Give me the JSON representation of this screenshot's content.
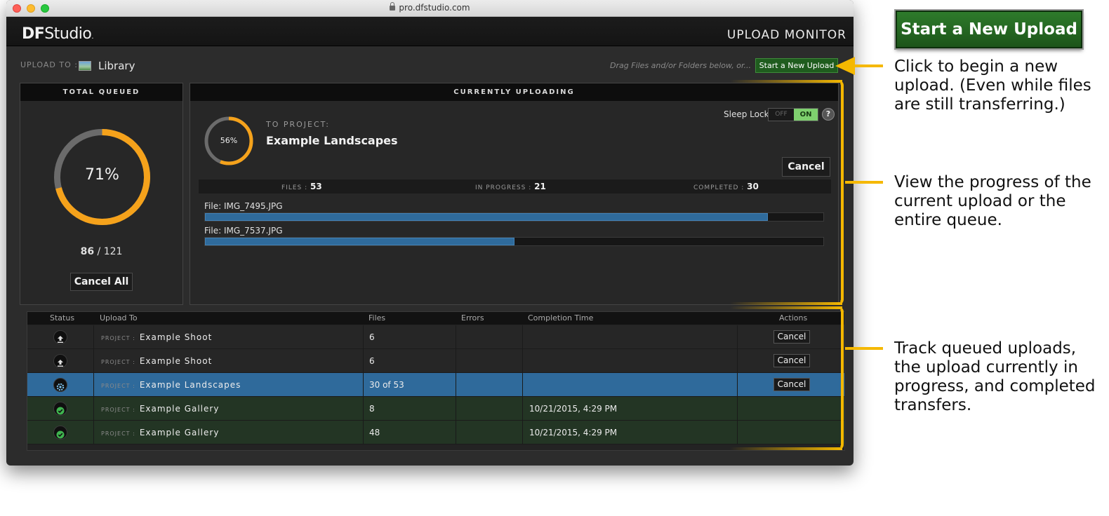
{
  "browser": {
    "url": "pro.dfstudio.com"
  },
  "header": {
    "logo_df": "DF",
    "logo_studio": "Studio",
    "logo_mark": ".",
    "title": "UPLOAD MONITOR"
  },
  "upload_to": {
    "label": "UPLOAD TO :",
    "destination": "Library",
    "drag_hint": "Drag Files and/or Folders below, or...",
    "start_button": "Start a New Upload"
  },
  "total_queued": {
    "title": "TOTAL QUEUED",
    "percent": 71,
    "percent_label": "71%",
    "done": "86",
    "separator": "/",
    "total": "121",
    "cancel_all": "Cancel All"
  },
  "current": {
    "title": "CURRENTLY UPLOADING",
    "percent": 56,
    "percent_label": "56%",
    "to_project_label": "TO PROJECT:",
    "project": "Example Landscapes",
    "sleep_lock_label": "Sleep Lock:",
    "toggle_off": "OFF",
    "toggle_on": "ON",
    "help": "?",
    "cancel": "Cancel",
    "files_label": "FILES :",
    "files_value": "53",
    "in_progress_label": "IN PROGRESS :",
    "in_progress_value": "21",
    "completed_label": "COMPLETED :",
    "completed_value": "30",
    "files": [
      {
        "name": "File: IMG_7495.JPG",
        "progress": 0.91
      },
      {
        "name": "File: IMG_7537.JPG",
        "progress": 0.5
      }
    ]
  },
  "table": {
    "columns": [
      "Status",
      "Upload To",
      "Files",
      "Errors",
      "Completion Time",
      "Actions"
    ],
    "prefix": "PROJECT :",
    "rows": [
      {
        "status": "queued",
        "project": "Example Shoot",
        "files": "6",
        "errors": "",
        "time": "",
        "action": "Cancel"
      },
      {
        "status": "queued",
        "project": "Example Shoot",
        "files": "6",
        "errors": "",
        "time": "",
        "action": "Cancel"
      },
      {
        "status": "uploading",
        "project": "Example Landscapes",
        "files": "30 of 53",
        "errors": "",
        "time": "",
        "action": "Cancel"
      },
      {
        "status": "complete",
        "project": "Example Gallery",
        "files": "8",
        "errors": "",
        "time": "10/21/2015, 4:29 PM",
        "action": ""
      },
      {
        "status": "complete",
        "project": "Example Gallery",
        "files": "48",
        "errors": "",
        "time": "10/21/2015, 4:29 PM",
        "action": ""
      }
    ]
  },
  "callouts": {
    "start_button": "Start a New Upload",
    "c1": "Click to begin a new upload. (Even while files are still transferring.)",
    "c2": "View the progress of the current upload or the entire queue.",
    "c3": "Track queued uploads, the upload currently in progress, and completed transfers."
  },
  "colors": {
    "accent_green": "#1f5c1e",
    "ring_orange": "#f5a21b",
    "ring_gray": "#6b6b6b",
    "progress_blue": "#2f6b9c",
    "selected_row": "#2f6a9b",
    "completed_row": "#233524",
    "callout_yellow": "#f5b800"
  },
  "icons": {
    "queued": "upload-icon",
    "uploading": "gear-icon",
    "complete": "check-circle-icon",
    "library": "image-icon"
  }
}
